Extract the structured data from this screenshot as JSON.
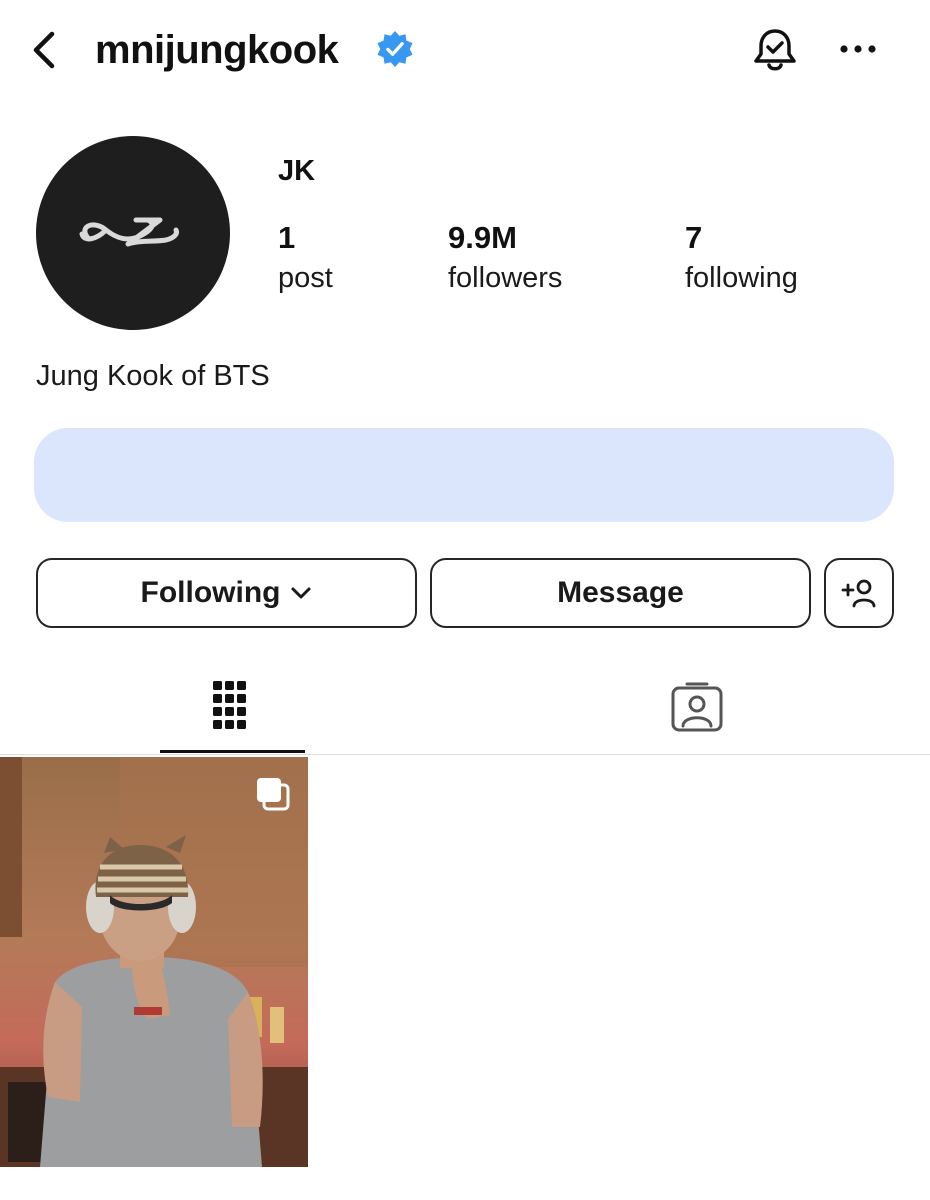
{
  "header": {
    "username": "mnijungkook",
    "verified": true,
    "back_icon": "chevron-left-icon",
    "bell_icon": "bell-check-icon",
    "more_icon": "more-horizontal-icon"
  },
  "profile": {
    "display_name": "JK",
    "avatar_logo": "infinity-jz-logo",
    "stats": {
      "posts": {
        "value": "1",
        "label": "post"
      },
      "followers": {
        "value": "9.9M",
        "label": "followers"
      },
      "following": {
        "value": "7",
        "label": "following"
      }
    },
    "bio": "Jung Kook of BTS"
  },
  "actions": {
    "following_label": "Following",
    "message_label": "Message",
    "add_user_icon": "add-user-icon"
  },
  "tabs": [
    {
      "name": "posts-grid",
      "icon": "grid-icon",
      "active": true
    },
    {
      "name": "tagged",
      "icon": "tagged-user-icon",
      "active": false
    }
  ],
  "posts": [
    {
      "type": "carousel",
      "icon": "carousel-icon"
    }
  ],
  "colors": {
    "verified_blue": "#3897f0",
    "banner": "#dbe6fc",
    "avatar_bg": "#1e1e1e"
  }
}
